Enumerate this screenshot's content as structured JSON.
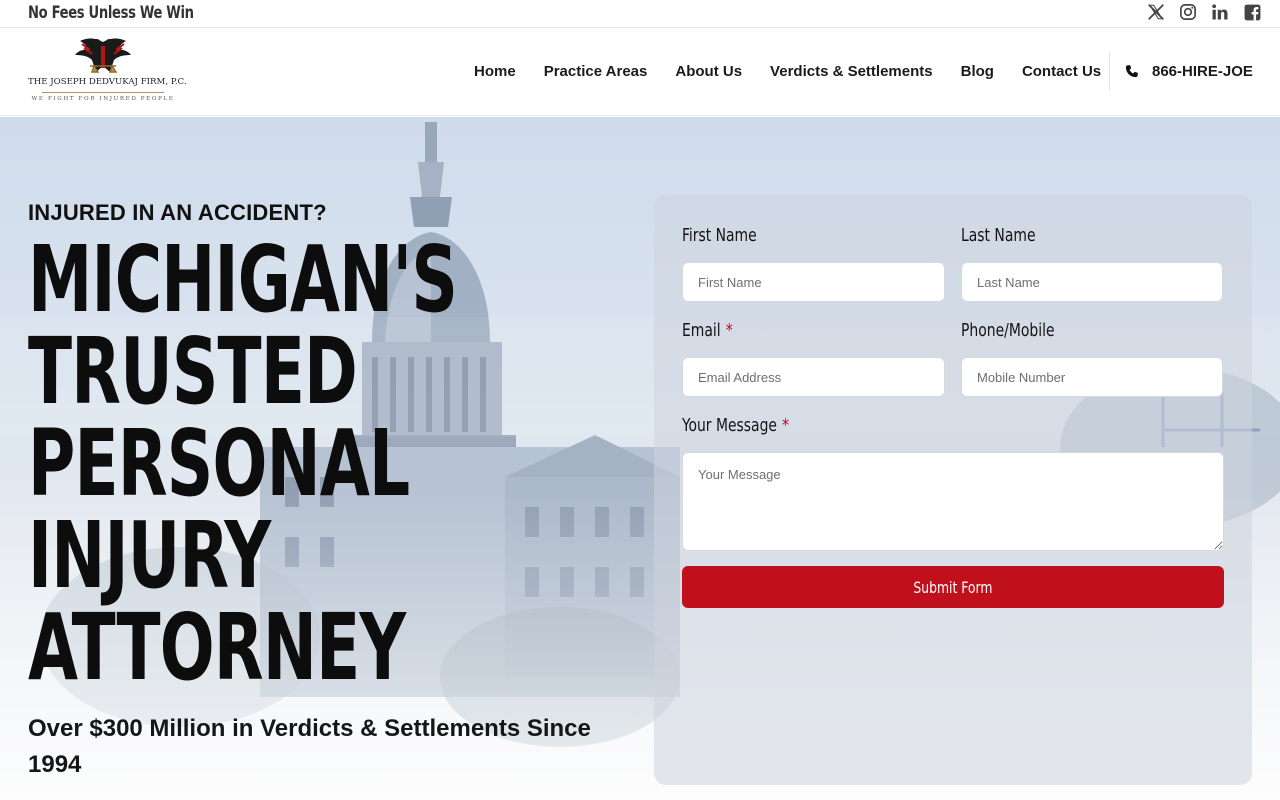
{
  "topbar": {
    "tagline": "No Fees Unless We Win",
    "social": [
      {
        "icon": "x-twitter-icon"
      },
      {
        "icon": "instagram-icon"
      },
      {
        "icon": "linkedin-icon"
      },
      {
        "icon": "facebook-icon"
      }
    ]
  },
  "header": {
    "logo": {
      "firm_name": "THE JOSEPH DEDVUKAJ FIRM, P.C.",
      "motto": "WE FIGHT FOR INJURED PEOPLE"
    },
    "nav": [
      "Home",
      "Practice Areas",
      "About Us",
      "Verdicts & Settlements",
      "Blog",
      "Contact Us"
    ],
    "phone": "866-HIRE-JOE"
  },
  "hero": {
    "eyebrow": "INJURED IN AN ACCIDENT?",
    "headline": [
      "MICHIGAN'S",
      "TRUSTED",
      "PERSONAL",
      "INJURY",
      "ATTORNEY"
    ],
    "subline": "Over $300 Million in Verdicts & Settlements Since 1994"
  },
  "form": {
    "first_name": {
      "label": "First Name",
      "placeholder": "First Name"
    },
    "last_name": {
      "label": "Last Name",
      "placeholder": "Last Name"
    },
    "email": {
      "label": "Email",
      "placeholder": "Email Address",
      "required_mark": "*"
    },
    "phone": {
      "label": "Phone/Mobile",
      "placeholder": "Mobile Number"
    },
    "message": {
      "label": "Your Message",
      "placeholder": "Your Message",
      "required_mark": "*"
    },
    "submit": "Submit Form"
  },
  "colors": {
    "accent_red": "#c0101b",
    "text_dark": "#111111"
  }
}
